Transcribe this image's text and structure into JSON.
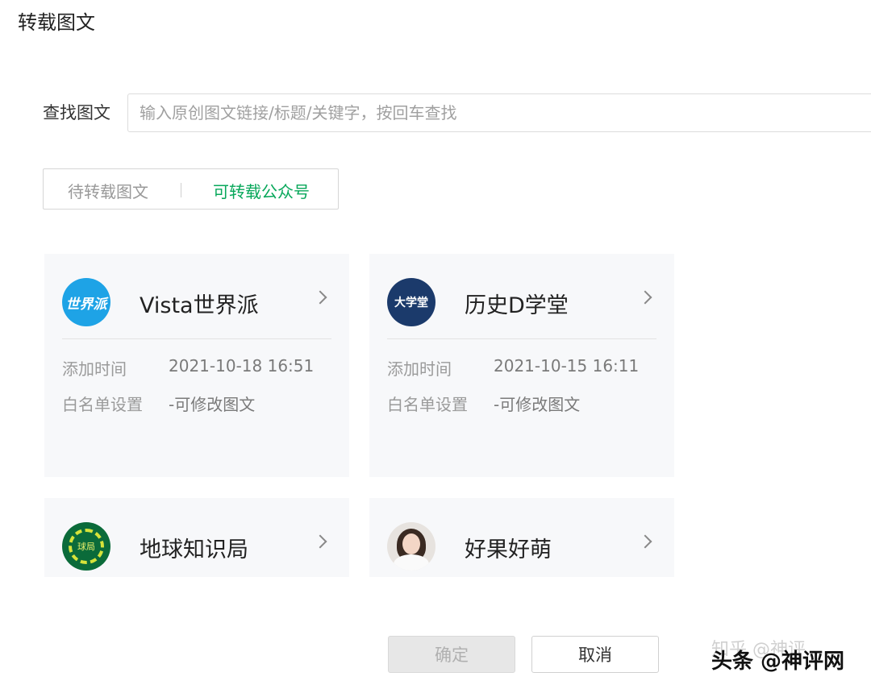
{
  "page": {
    "title": "转载图文"
  },
  "search": {
    "label": "查找图文",
    "placeholder": "输入原创图文链接/标题/关键字，按回车查找"
  },
  "tabs": [
    {
      "label": "待转载图文",
      "active": false
    },
    {
      "label": "可转载公众号",
      "active": true
    }
  ],
  "accounts": [
    {
      "name": "Vista世界派",
      "avatar_text": "世界派",
      "add_time_label": "添加时间",
      "add_time": "2021-10-18 16:51",
      "whitelist_label": "白名单设置",
      "whitelist_value": "-可修改图文"
    },
    {
      "name": "历史D学堂",
      "avatar_text": "大学堂",
      "add_time_label": "添加时间",
      "add_time": "2021-10-15 16:11",
      "whitelist_label": "白名单设置",
      "whitelist_value": "-可修改图文"
    },
    {
      "name": "地球知识局",
      "avatar_text": "球局"
    },
    {
      "name": "好果好萌"
    }
  ],
  "buttons": {
    "confirm": "确定",
    "cancel": "取消"
  },
  "watermark": {
    "text": "头条 @神评网",
    "faint": "知乎 @神评"
  },
  "colors": {
    "accent": "#07a75a",
    "card_bg": "#f7f8fa"
  }
}
